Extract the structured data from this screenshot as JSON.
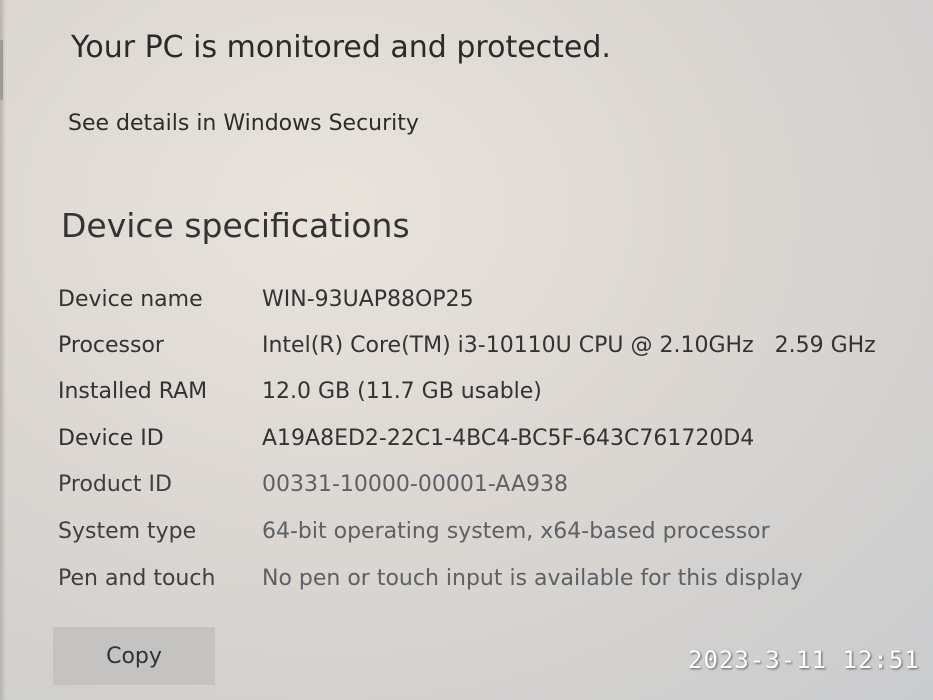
{
  "protection": {
    "title": "Your PC is monitored and protected.",
    "link": "See details in Windows Security"
  },
  "device_specs": {
    "heading": "Device specifications",
    "rows": [
      {
        "label": "Device name",
        "value": "WIN-93UAP88OP25"
      },
      {
        "label": "Processor",
        "value": "Intel(R) Core(TM) i3-10110U CPU @ 2.10GHz   2.59 GHz"
      },
      {
        "label": "Installed RAM",
        "value": "12.0 GB (11.7 GB usable)"
      },
      {
        "label": "Device ID",
        "value": "A19A8ED2-22C1-4BC4-BC5F-643C761720D4"
      },
      {
        "label": "Product ID",
        "value": "00331-10000-00001-AA938"
      },
      {
        "label": "System type",
        "value": "64-bit operating system, x64-based processor"
      },
      {
        "label": "Pen and touch",
        "value": "No pen or touch input is available for this display"
      }
    ],
    "copy_label": "Copy"
  },
  "photo_timestamp": "2023-3-11 12:51"
}
